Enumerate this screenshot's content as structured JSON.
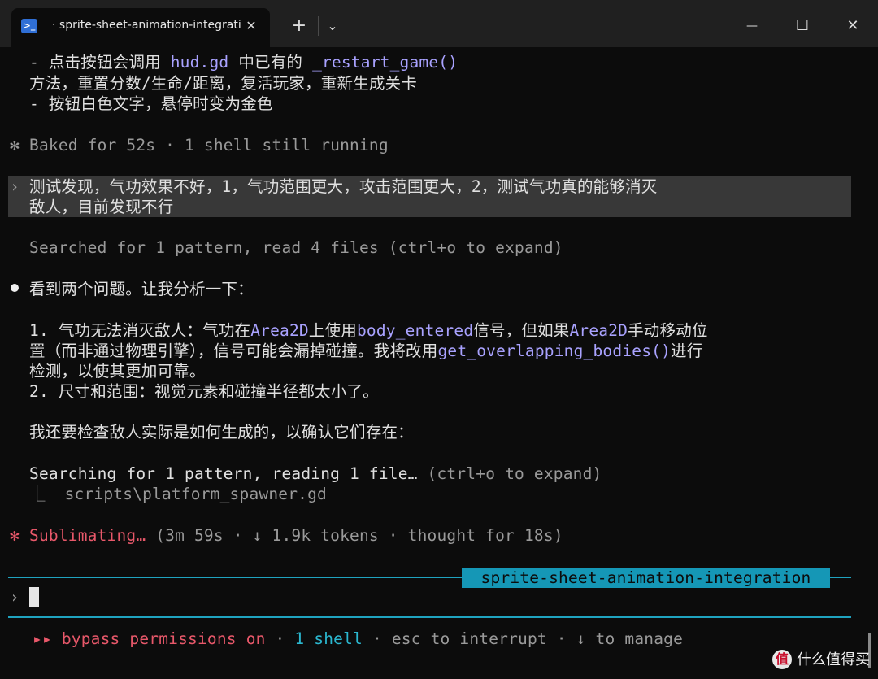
{
  "titlebar": {
    "tab_title": "· sprite-sheet-animation-integration",
    "close_glyph": "✕",
    "new_tab_glyph": "+",
    "dropdown_glyph": "⌄",
    "minimize_glyph": "—",
    "maximize_glyph": "☐",
    "window_close_glyph": "✕"
  },
  "terminal": {
    "block1": {
      "l1_a": "- 点击按钮会调用 ",
      "l1_b": "hud.gd",
      "l1_c": " 中已有的 ",
      "l1_d": "_restart_game()",
      "l2": "方法，重置分数/生命/距离，复活玩家，重新生成关卡",
      "l3": "- 按钮白色文字，悬停时变为金色"
    },
    "baked": {
      "icon": "✻",
      "text": "Baked for 52s · 1 shell still running"
    },
    "user_prompt": {
      "marker": "›",
      "line1": "测试发现，气功效果不好，1，气功范围更大，攻击范围更大，2，测试气功真的能够消灭",
      "line2": "敌人，目前发现不行"
    },
    "searched": "Searched for 1 pattern, read 4 files (ctrl+o to expand)",
    "reply": {
      "intro": "看到两个问题。让我分析一下：",
      "p1_a": "1. 气功无法消灭敌人：气功在",
      "p1_b": "Area2D",
      "p1_c": "上使用",
      "p1_d": "body_entered",
      "p1_e": "信号，但如果",
      "p1_f": "Area2D",
      "p1_g": "手动移动位",
      "p2_a": "置（而非通过物理引擎），信号可能会漏掉碰撞。我将改用",
      "p2_b": "get_overlapping_bodies()",
      "p2_c": "进行",
      "p3": "检测，以使其更加可靠。",
      "p4": "2. 尺寸和范围：视觉元素和碰撞半径都太小了。",
      "p5": "我还要检查敌人实际是如何生成的，以确认它们存在："
    },
    "searching": {
      "bold": "Searching for 1 pattern, reading 1 file…",
      "hint": " (ctrl+o to expand)",
      "file": "⎿  scripts\\platform_spawner.gd"
    },
    "status": {
      "icon": "✻",
      "label": "Sublimating…",
      "detail": " (3m 59s · ↓ 1.9k tokens · thought for 18s)"
    },
    "branch": "sprite-sheet-animation-integration",
    "prompt_marker": "›",
    "footer": {
      "arrows": "▸▸",
      "bypass": " bypass permissions on",
      "sep1": " · ",
      "shell": "1 shell",
      "rest": " · esc to interrupt · ↓ to manage"
    }
  },
  "watermark": {
    "icon": "值",
    "text": "什么值得买"
  }
}
